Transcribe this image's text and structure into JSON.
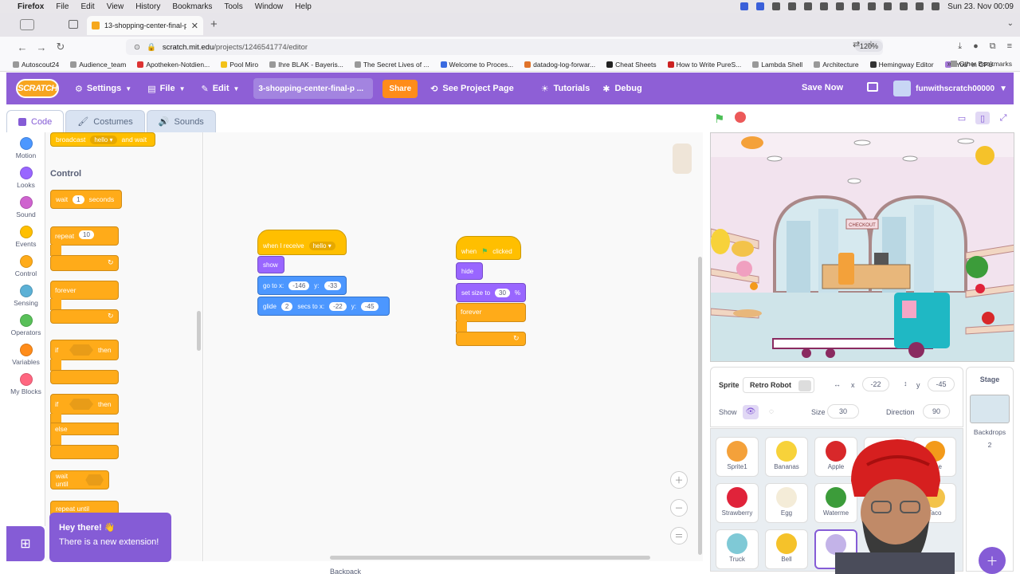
{
  "macbar": {
    "menus": [
      "Firefox",
      "File",
      "Edit",
      "View",
      "History",
      "Bookmarks",
      "Tools",
      "Window",
      "Help"
    ],
    "clock": "Sun 23. Nov 00:09"
  },
  "browser": {
    "tab_title": "13-shopping-center-final-proje",
    "url_host": "scratch.mit.edu",
    "url_path": "/projects/1246541774/editor",
    "zoom": "120%"
  },
  "bookmarks": {
    "items": [
      "Autoscout24",
      "Audience_team",
      "Apotheken-Notdien...",
      "Pool Miro",
      "Ihre BLAK - Bayeris...",
      "The Secret Lives of ...",
      "Welcome to Proces...",
      "datadog-log-forwar...",
      "Cheat Sheets",
      "How to Write PureS...",
      "Lambda Shell",
      "Architecture",
      "Hemingway Editor",
      "\"You\" in CPU"
    ],
    "other": "Other Bookmarks"
  },
  "scratch_menu": {
    "logo": "SCRATCH",
    "settings": "Settings",
    "file": "File",
    "edit": "Edit",
    "project_title": "3-shopping-center-final-p ...",
    "share": "Share",
    "see_project": "See Project Page",
    "tutorials": "Tutorials",
    "debug": "Debug",
    "save_now": "Save Now",
    "username": "funwithscratch00000"
  },
  "editor_tabs": {
    "code": "Code",
    "costumes": "Costumes",
    "sounds": "Sounds"
  },
  "categories": [
    {
      "label": "Motion",
      "color": "#4c97ff"
    },
    {
      "label": "Looks",
      "color": "#9966ff"
    },
    {
      "label": "Sound",
      "color": "#cf63cf"
    },
    {
      "label": "Events",
      "color": "#ffbf00"
    },
    {
      "label": "Control",
      "color": "#ffab19"
    },
    {
      "label": "Sensing",
      "color": "#5cb1d6"
    },
    {
      "label": "Operators",
      "color": "#59c059"
    },
    {
      "label": "Variables",
      "color": "#ff8c1a"
    },
    {
      "label": "My Blocks",
      "color": "#ff6680"
    }
  ],
  "palette": {
    "broadcast": {
      "prefix": "broadcast",
      "msg": "hello",
      "suffix": "and wait"
    },
    "control_header": "Control",
    "wait": {
      "prefix": "wait",
      "value": "1",
      "suffix": "seconds"
    },
    "repeat": {
      "label": "repeat",
      "value": "10"
    },
    "forever": "forever",
    "if_then": {
      "if": "if",
      "then": "then"
    },
    "if_else": {
      "if": "if",
      "then": "then",
      "else": "else"
    },
    "wait_until": "wait until",
    "repeat_until": "repeat until"
  },
  "toast": {
    "title": "Hey there! 👋",
    "body": "There is a new extension!"
  },
  "scripts": {
    "s1": {
      "hat": "when I receive",
      "msg": "hello",
      "show": "show",
      "goto": {
        "prefix": "go to x:",
        "x": "-146",
        "ylabel": "y:",
        "y": "-33"
      },
      "glide": {
        "prefix": "glide",
        "secs": "2",
        "mid": "secs to x:",
        "x": "-22",
        "ylabel": "y:",
        "y": "-45"
      }
    },
    "s2": {
      "hat_prefix": "when",
      "hat_suffix": "clicked",
      "hide": "hide",
      "size": {
        "prefix": "set size to",
        "value": "30",
        "suffix": "%"
      },
      "forever": "forever"
    }
  },
  "backpack": "Backpack",
  "sprite_info": {
    "sprite_label": "Sprite",
    "sprite_name": "Retro Robot",
    "x_label": "x",
    "x": "-22",
    "y_label": "y",
    "y": "-45",
    "show_label": "Show",
    "size_label": "Size",
    "size": "30",
    "direction_label": "Direction",
    "direction": "90"
  },
  "sprites": [
    {
      "name": "Sprite1",
      "color": "#f4a13a"
    },
    {
      "name": "Bananas",
      "color": "#f7d23a"
    },
    {
      "name": "Apple",
      "color": "#d8282a"
    },
    {
      "name": "",
      "color": "#eeeeee"
    },
    {
      "name": "ange",
      "color": "#f39a1a"
    },
    {
      "name": "Strawberry",
      "color": "#e0233a"
    },
    {
      "name": "Egg",
      "color": "#f4ecd8"
    },
    {
      "name": "Waterme",
      "color": "#3c9c3a"
    },
    {
      "name": "",
      "color": "#eeeeee"
    },
    {
      "name": "Taco",
      "color": "#f3c34a"
    },
    {
      "name": "Truck",
      "color": "#7fc9d6"
    },
    {
      "name": "Bell",
      "color": "#f5c22a"
    },
    {
      "name": "",
      "color": "#c3b3e8"
    }
  ],
  "stage_panel": {
    "title": "Stage",
    "backdrops_label": "Backdrops",
    "backdrops_count": "2"
  },
  "stage_scene": {
    "checkout_sign": "CHECKOUT"
  }
}
